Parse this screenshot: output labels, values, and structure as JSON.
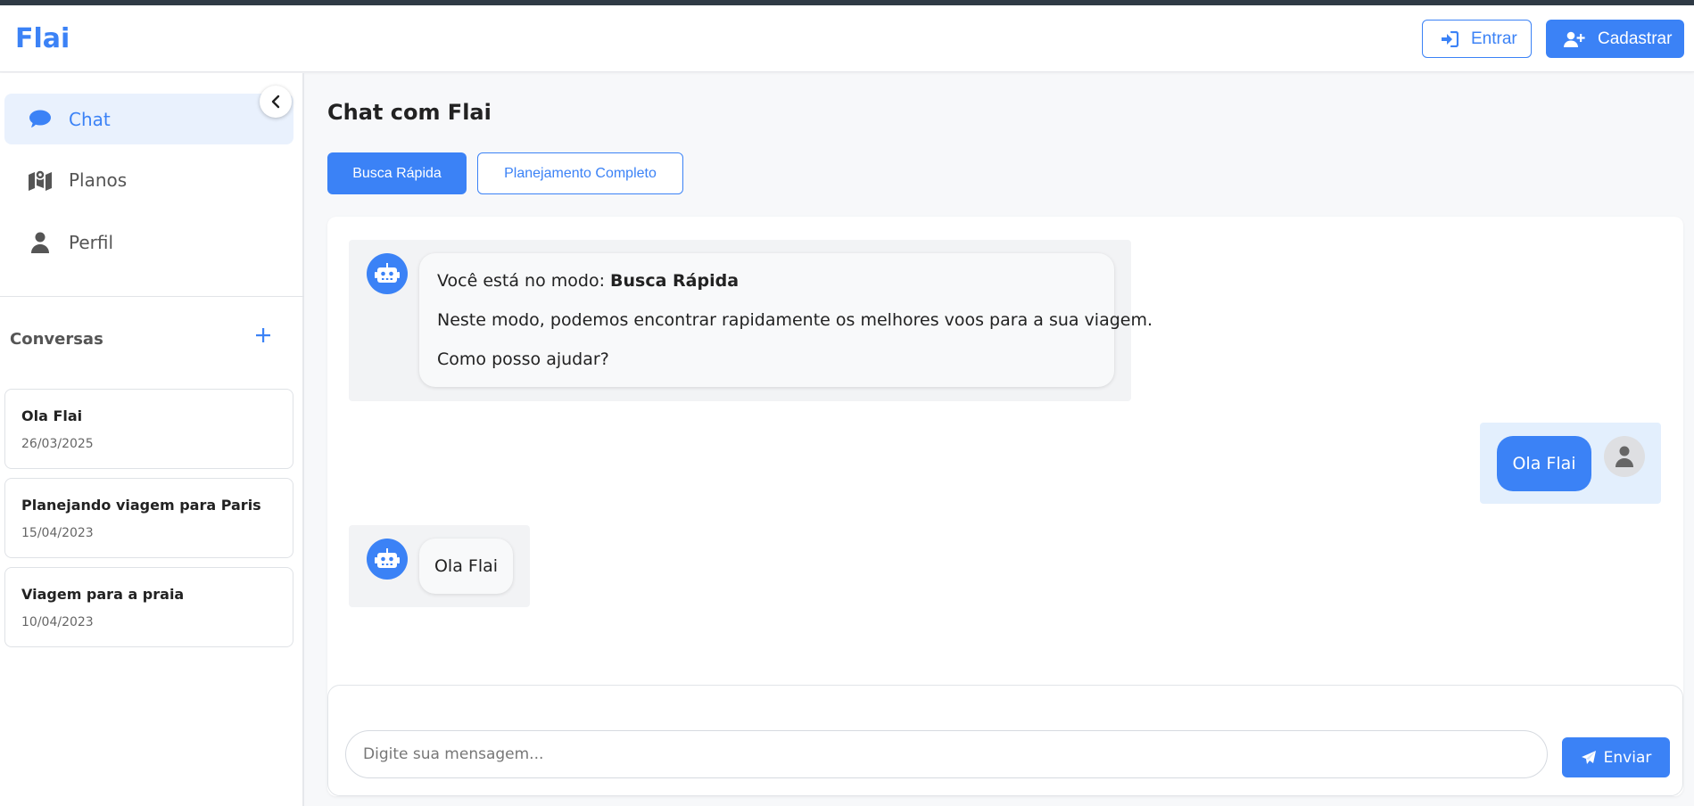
{
  "app": {
    "brand": "Flai"
  },
  "header": {
    "login_label": "Entrar",
    "signup_label": "Cadastrar"
  },
  "sidebar": {
    "nav": [
      {
        "label": "Chat",
        "icon": "comment-icon",
        "active": true
      },
      {
        "label": "Planos",
        "icon": "map-location-icon",
        "active": false
      },
      {
        "label": "Perfil",
        "icon": "user-icon",
        "active": false
      }
    ],
    "conversations_title": "Conversas",
    "conversations": [
      {
        "title": "Ola Flai",
        "date": "26/03/2025"
      },
      {
        "title": "Planejando viagem para Paris",
        "date": "15/04/2023"
      },
      {
        "title": "Viagem para a praia",
        "date": "10/04/2023"
      }
    ]
  },
  "main": {
    "title": "Chat com Flai",
    "modes": {
      "quick": "Busca Rápida",
      "full": "Planejamento Completo",
      "selected": "Busca Rápida"
    },
    "messages": [
      {
        "from": "bot",
        "mode_prefix": "Você está no modo:",
        "mode_name": "Busca Rápida",
        "line2": "Neste modo, podemos encontrar rapidamente os melhores voos para a sua viagem.",
        "line3": "Como posso ajudar?"
      },
      {
        "from": "user",
        "text": "Ola Flai"
      },
      {
        "from": "bot",
        "text": "Ola Flai"
      }
    ],
    "input_placeholder": "Digite sua mensagem...",
    "send_label": "Enviar"
  },
  "colors": {
    "accent": "#3b82f6",
    "user_row": "#e3effd",
    "bot_row": "#f2f3f5"
  }
}
